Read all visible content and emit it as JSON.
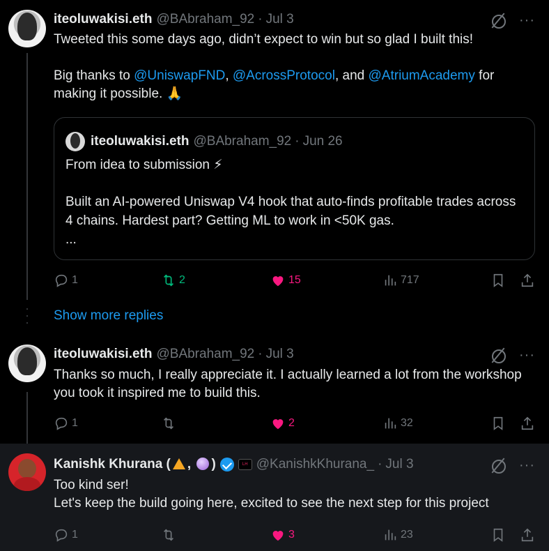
{
  "tweets": [
    {
      "name": "iteoluwakisi.eth",
      "handle": "@BAbraham_92",
      "date": "Jul 3",
      "text_1": "Tweeted this some days ago, didn’t expect to win but so glad I built this!",
      "text_2_prefix": "Big thanks to ",
      "mention_1": "@UniswapFND",
      "sep_1": ", ",
      "mention_2": "@AcrossProtocol",
      "sep_2": ", and ",
      "mention_3": "@AtriumAcademy",
      "text_2_suffix": " for making it possible. 🙏",
      "quote": {
        "name": "iteoluwakisi.eth",
        "handle": "@BAbraham_92",
        "date": "Jun 26",
        "line_1": "From idea to submission ⚡",
        "line_2": "Built an AI-powered Uniswap V4 hook that auto-finds profitable trades across 4 chains. Hardest part? Getting ML to work in <50K gas.",
        "line_3": "..."
      },
      "stats": {
        "replies": "1",
        "retweets": "2",
        "likes": "15",
        "views": "717"
      }
    },
    {
      "name": "iteoluwakisi.eth",
      "handle": "@BAbraham_92",
      "date": "Jul 3",
      "text": "Thanks so much, I really appreciate it. I actually learned a lot from the workshop you took it inspired me to build this.",
      "stats": {
        "replies": "1",
        "retweets": "",
        "likes": "2",
        "views": "32"
      }
    },
    {
      "name_prefix": "Kanishk Khurana (",
      "name_comma": ", ",
      "name_suffix": ")",
      "affiliate_badge": "LH",
      "handle": "@KanishkKhurana_",
      "date": "Jul 3",
      "line_1": "Too kind ser!",
      "line_2": "Let's keep the build going here, excited to see the next step for this project",
      "stats": {
        "replies": "1",
        "retweets": "",
        "likes": "3",
        "views": "23"
      }
    }
  ],
  "show_more_replies": "Show more replies",
  "separator": "·",
  "more": "···",
  "colors": {
    "background": "#000000",
    "highlight": "#16181c",
    "text": "#e7e9ea",
    "muted": "#71767b",
    "link": "#1d9bf0",
    "retweet": "#00ba7c",
    "like": "#f91880"
  }
}
